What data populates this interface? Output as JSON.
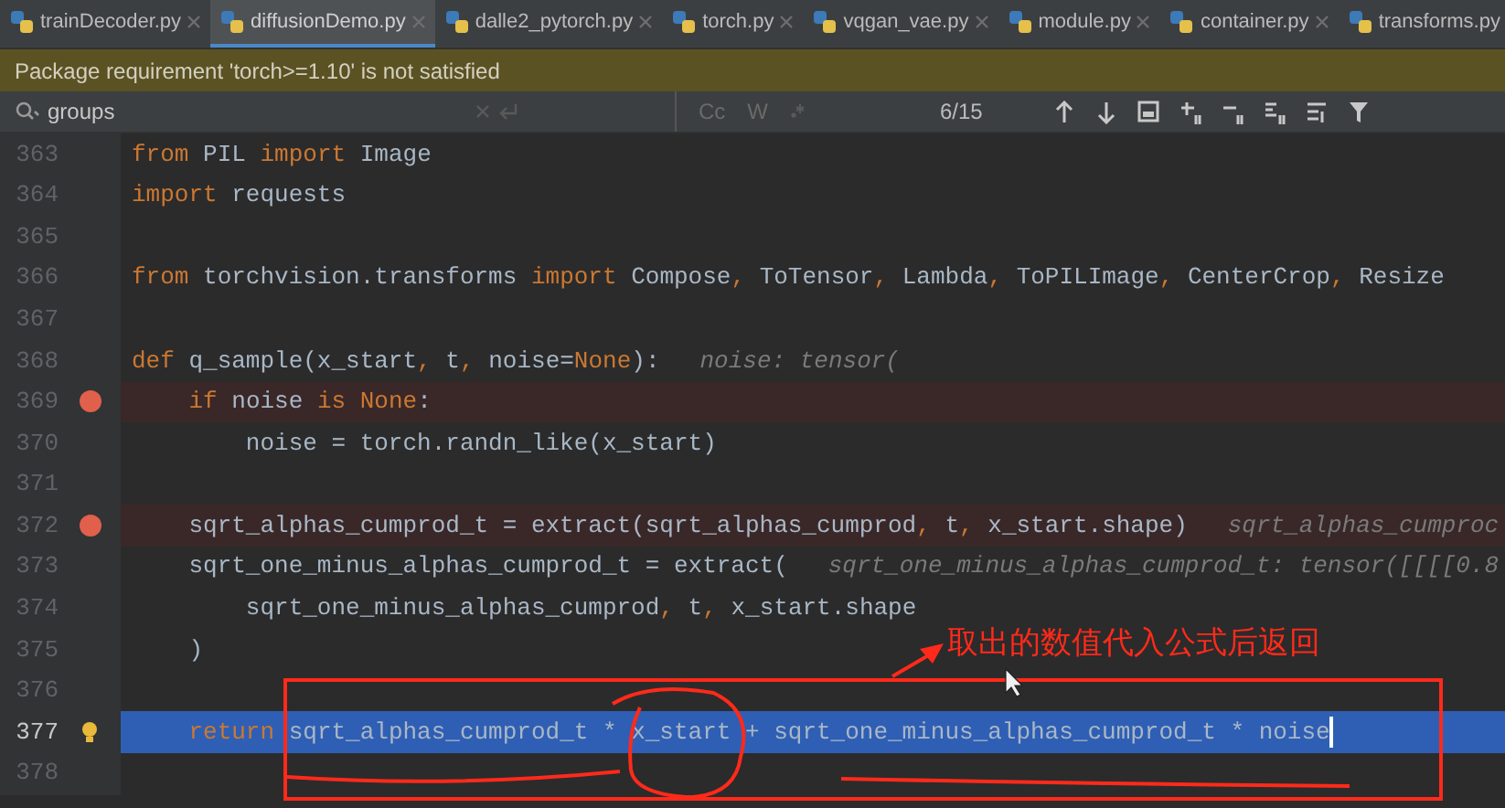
{
  "tabs": [
    {
      "label": "trainDecoder.py",
      "selected": false
    },
    {
      "label": "diffusionDemo.py",
      "selected": true
    },
    {
      "label": "dalle2_pytorch.py",
      "selected": false
    },
    {
      "label": "torch.py",
      "selected": false
    },
    {
      "label": "vqgan_vae.py",
      "selected": false
    },
    {
      "label": "module.py",
      "selected": false
    },
    {
      "label": "container.py",
      "selected": false
    },
    {
      "label": "transforms.py",
      "selected": false
    }
  ],
  "banner": {
    "text": "Package requirement 'torch>=1.10' is not satisfied"
  },
  "search": {
    "value": "groups",
    "case_label": "Cc",
    "words_label": "W",
    "match_count": "6/15"
  },
  "lines": [
    {
      "number": "363",
      "breakpoint": false,
      "current": false,
      "segments": [
        {
          "kind": "keyword",
          "text": "from"
        },
        {
          "kind": "text",
          "text": " PIL "
        },
        {
          "kind": "keyword",
          "text": "import"
        },
        {
          "kind": "text",
          "text": " Image"
        }
      ]
    },
    {
      "number": "364",
      "breakpoint": false,
      "current": false,
      "segments": [
        {
          "kind": "keyword",
          "text": "import"
        },
        {
          "kind": "text",
          "text": " requests"
        }
      ]
    },
    {
      "number": "365",
      "breakpoint": false,
      "current": false
    },
    {
      "number": "366",
      "breakpoint": false,
      "current": false,
      "segments": [
        {
          "kind": "keyword",
          "text": "from"
        },
        {
          "kind": "text",
          "text": " torchvision.transforms "
        },
        {
          "kind": "keyword",
          "text": "import"
        },
        {
          "kind": "text",
          "text": " Compose"
        },
        {
          "kind": "punct",
          "text": ","
        },
        {
          "kind": "text",
          "text": " ToTensor"
        },
        {
          "kind": "punct",
          "text": ","
        },
        {
          "kind": "text",
          "text": " Lambda"
        },
        {
          "kind": "punct",
          "text": ","
        },
        {
          "kind": "text",
          "text": " ToPILImage"
        },
        {
          "kind": "punct",
          "text": ","
        },
        {
          "kind": "text",
          "text": " CenterCrop"
        },
        {
          "kind": "punct",
          "text": ","
        },
        {
          "kind": "text",
          "text": " Resize"
        }
      ]
    },
    {
      "number": "367",
      "breakpoint": false,
      "current": false
    },
    {
      "number": "368",
      "breakpoint": false,
      "current": false,
      "segments": [
        {
          "kind": "keyword",
          "text": "def"
        },
        {
          "kind": "text",
          "text": " q_sample(x_start"
        },
        {
          "kind": "punct",
          "text": ","
        },
        {
          "kind": "text",
          "text": " t"
        },
        {
          "kind": "punct",
          "text": ","
        },
        {
          "kind": "text",
          "text": " noise="
        },
        {
          "kind": "keyword",
          "text": "None"
        },
        {
          "kind": "text",
          "text": "):"
        },
        {
          "kind": "hint",
          "text": "noise: tensor("
        }
      ]
    },
    {
      "number": "369",
      "breakpoint": true,
      "current": false,
      "segments": [
        {
          "kind": "keyword",
          "text": "    if"
        },
        {
          "kind": "text",
          "text": " noise "
        },
        {
          "kind": "keyword",
          "text": "is None"
        },
        {
          "kind": "text",
          "text": ":"
        }
      ]
    },
    {
      "number": "370",
      "breakpoint": false,
      "current": false,
      "segments": [
        {
          "kind": "text",
          "text": "        noise = torch.randn_like(x_start)"
        }
      ]
    },
    {
      "number": "371",
      "breakpoint": false,
      "current": false
    },
    {
      "number": "372",
      "breakpoint": true,
      "current": false,
      "segments": [
        {
          "kind": "text",
          "text": "    sqrt_alphas_cumprod_t = extract(sqrt_alphas_cumprod"
        },
        {
          "kind": "punct",
          "text": ","
        },
        {
          "kind": "text",
          "text": " t"
        },
        {
          "kind": "punct",
          "text": ","
        },
        {
          "kind": "text",
          "text": " x_start.shape)"
        },
        {
          "kind": "hint",
          "text": "sqrt_alphas_cumproc"
        }
      ]
    },
    {
      "number": "373",
      "breakpoint": false,
      "current": false,
      "segments": [
        {
          "kind": "text",
          "text": "    sqrt_one_minus_alphas_cumprod_t = extract("
        },
        {
          "kind": "hint",
          "text": "sqrt_one_minus_alphas_cumprod_t: tensor([[[[0.8"
        }
      ]
    },
    {
      "number": "374",
      "breakpoint": false,
      "current": false,
      "segments": [
        {
          "kind": "text",
          "text": "        sqrt_one_minus_alphas_cumprod"
        },
        {
          "kind": "punct",
          "text": ","
        },
        {
          "kind": "text",
          "text": " t"
        },
        {
          "kind": "punct",
          "text": ","
        },
        {
          "kind": "text",
          "text": " x_start.shape"
        }
      ]
    },
    {
      "number": "375",
      "breakpoint": false,
      "current": false,
      "segments": [
        {
          "kind": "text",
          "text": "    )"
        }
      ]
    },
    {
      "number": "376",
      "breakpoint": false,
      "current": false
    },
    {
      "number": "377",
      "breakpoint": false,
      "current": true,
      "segments": [
        {
          "kind": "keyword",
          "text": "    return"
        },
        {
          "kind": "text",
          "text": " sqrt_alphas_cumprod_t * x_start + sqrt_one_minus_alphas_cumprod_t * noise"
        }
      ]
    },
    {
      "number": "378",
      "breakpoint": false,
      "current": false
    }
  ],
  "annotation": {
    "text": "取出的数值代入公式后返回"
  }
}
